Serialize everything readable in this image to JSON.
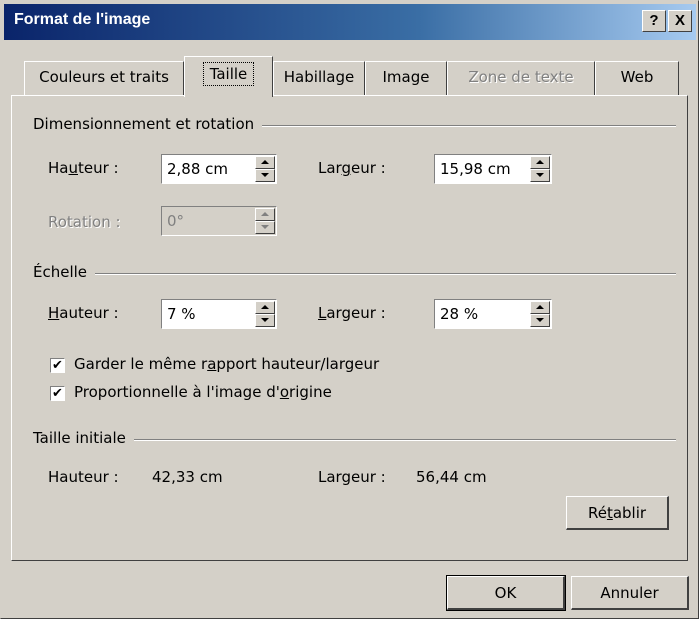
{
  "window": {
    "title": "Format de l'image",
    "help_label": "?",
    "close_label": "X"
  },
  "tabs": [
    {
      "label": "Couleurs et traits",
      "state": "normal"
    },
    {
      "label": "Taille",
      "state": "active"
    },
    {
      "label": "Habillage",
      "state": "normal"
    },
    {
      "label": "Image",
      "state": "normal"
    },
    {
      "label": "Zone de texte",
      "state": "disabled"
    },
    {
      "label": "Web",
      "state": "normal"
    }
  ],
  "size_rotation": {
    "section_label": "Dimensionnement et rotation",
    "height_label_pre": "Ha",
    "height_label_key": "u",
    "height_label_post": "teur :",
    "height_value": "2,88 cm",
    "width_label_pre": "Lar",
    "width_label_key": "g",
    "width_label_post": "eur :",
    "width_value": "15,98 cm",
    "rotation_label": "Rotation :",
    "rotation_value": "0°"
  },
  "scale": {
    "section_label": "Échelle",
    "height_label_key": "H",
    "height_label_post": "auteur :",
    "height_value": "7 %",
    "width_label_key": "L",
    "width_label_post": "argeur :",
    "width_value": "28 %",
    "lock_ratio_pre": "Garder le même r",
    "lock_ratio_key": "a",
    "lock_ratio_post": "pport hauteur/largeur",
    "lock_ratio_checked": true,
    "relative_pre": "Proportionnelle à l'image d'",
    "relative_key": "o",
    "relative_post": "rigine",
    "relative_checked": true,
    "check_glyph": "✔"
  },
  "original_size": {
    "section_label": "Taille initiale",
    "height_label": "Hauteur :",
    "height_value": "42,33 cm",
    "width_label": "Largeur :",
    "width_value": "56,44 cm",
    "reset_pre": "Ré",
    "reset_key": "t",
    "reset_post": "ablir"
  },
  "buttons": {
    "ok_label": "OK",
    "cancel_label": "Annuler"
  },
  "colors": {
    "titlebar_start": "#0a246a",
    "titlebar_end": "#a6caf0",
    "face": "#d4d0c8"
  }
}
